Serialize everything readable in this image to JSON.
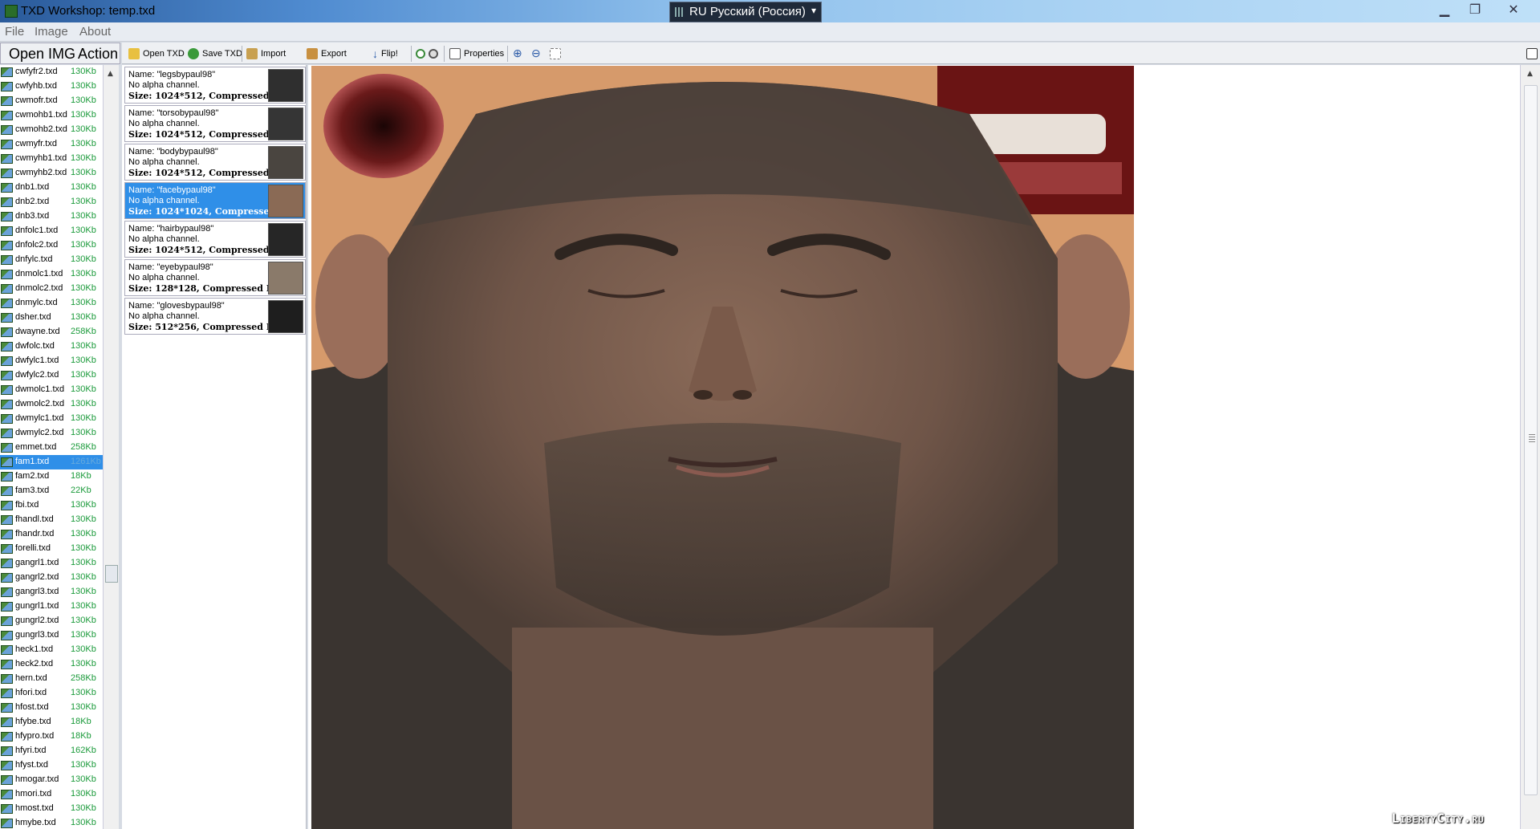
{
  "window": {
    "title": "TXD Workshop: temp.txd",
    "language_indicator": "RU Русский (Россия)",
    "controls": [
      "minimize",
      "maximize",
      "close"
    ]
  },
  "menu": [
    "File",
    "Image",
    "About"
  ],
  "left_header": {
    "tab1": "Open IMG",
    "tab2": "Action"
  },
  "toolbar": {
    "open_txd": "Open TXD",
    "save_txd": "Save TXD",
    "import": "Import",
    "export": "Export",
    "flip": "Flip!",
    "properties": "Properties"
  },
  "files": [
    {
      "name": "cwfyfr2.txd",
      "size": "130Kb"
    },
    {
      "name": "cwfyhb.txd",
      "size": "130Kb"
    },
    {
      "name": "cwmofr.txd",
      "size": "130Kb"
    },
    {
      "name": "cwmohb1.txd",
      "size": "130Kb"
    },
    {
      "name": "cwmohb2.txd",
      "size": "130Kb"
    },
    {
      "name": "cwmyfr.txd",
      "size": "130Kb"
    },
    {
      "name": "cwmyhb1.txd",
      "size": "130Kb"
    },
    {
      "name": "cwmyhb2.txd",
      "size": "130Kb"
    },
    {
      "name": "dnb1.txd",
      "size": "130Kb"
    },
    {
      "name": "dnb2.txd",
      "size": "130Kb"
    },
    {
      "name": "dnb3.txd",
      "size": "130Kb"
    },
    {
      "name": "dnfolc1.txd",
      "size": "130Kb"
    },
    {
      "name": "dnfolc2.txd",
      "size": "130Kb"
    },
    {
      "name": "dnfylc.txd",
      "size": "130Kb"
    },
    {
      "name": "dnmolc1.txd",
      "size": "130Kb"
    },
    {
      "name": "dnmolc2.txd",
      "size": "130Kb"
    },
    {
      "name": "dnmylc.txd",
      "size": "130Kb"
    },
    {
      "name": "dsher.txd",
      "size": "130Kb"
    },
    {
      "name": "dwayne.txd",
      "size": "258Kb"
    },
    {
      "name": "dwfolc.txd",
      "size": "130Kb"
    },
    {
      "name": "dwfylc1.txd",
      "size": "130Kb"
    },
    {
      "name": "dwfylc2.txd",
      "size": "130Kb"
    },
    {
      "name": "dwmolc1.txd",
      "size": "130Kb"
    },
    {
      "name": "dwmolc2.txd",
      "size": "130Kb"
    },
    {
      "name": "dwmylc1.txd",
      "size": "130Kb"
    },
    {
      "name": "dwmylc2.txd",
      "size": "130Kb"
    },
    {
      "name": "emmet.txd",
      "size": "258Kb"
    },
    {
      "name": "fam1.txd",
      "size": "1261Kb",
      "selected": true
    },
    {
      "name": "fam2.txd",
      "size": "18Kb"
    },
    {
      "name": "fam3.txd",
      "size": "22Kb"
    },
    {
      "name": "fbi.txd",
      "size": "130Kb"
    },
    {
      "name": "fhandl.txd",
      "size": "130Kb"
    },
    {
      "name": "fhandr.txd",
      "size": "130Kb"
    },
    {
      "name": "forelli.txd",
      "size": "130Kb"
    },
    {
      "name": "gangrl1.txd",
      "size": "130Kb"
    },
    {
      "name": "gangrl2.txd",
      "size": "130Kb"
    },
    {
      "name": "gangrl3.txd",
      "size": "130Kb"
    },
    {
      "name": "gungrl1.txd",
      "size": "130Kb"
    },
    {
      "name": "gungrl2.txd",
      "size": "130Kb"
    },
    {
      "name": "gungrl3.txd",
      "size": "130Kb"
    },
    {
      "name": "heck1.txd",
      "size": "130Kb"
    },
    {
      "name": "heck2.txd",
      "size": "130Kb"
    },
    {
      "name": "hern.txd",
      "size": "258Kb"
    },
    {
      "name": "hfori.txd",
      "size": "130Kb"
    },
    {
      "name": "hfost.txd",
      "size": "130Kb"
    },
    {
      "name": "hfybe.txd",
      "size": "18Kb"
    },
    {
      "name": "hfypro.txd",
      "size": "18Kb"
    },
    {
      "name": "hfyri.txd",
      "size": "162Kb"
    },
    {
      "name": "hfyst.txd",
      "size": "130Kb"
    },
    {
      "name": "hmogar.txd",
      "size": "130Kb"
    },
    {
      "name": "hmori.txd",
      "size": "130Kb"
    },
    {
      "name": "hmost.txd",
      "size": "130Kb"
    },
    {
      "name": "hmybe.txd",
      "size": "130Kb"
    }
  ],
  "textures": [
    {
      "name": "Name: \"legsbypaul98\"",
      "alpha": "No alpha channel.",
      "size": "Size: 1024*512, Compressed D",
      "thumb": "#2f2f2f"
    },
    {
      "name": "Name: \"torsobypaul98\"",
      "alpha": "No alpha channel.",
      "size": "Size: 1024*512, Compressed D",
      "thumb": "#353535"
    },
    {
      "name": "Name: \"bodybypaul98\"",
      "alpha": "No alpha channel.",
      "size": "Size: 1024*512, Compressed D",
      "thumb": "#4a4540"
    },
    {
      "name": "Name: \"facebypaul98\"",
      "alpha": "No alpha channel.",
      "size": "Size: 1024*1024, Compressed",
      "thumb": "#8a6a55",
      "selected": true
    },
    {
      "name": "Name: \"hairbypaul98\"",
      "alpha": "No alpha channel.",
      "size": "Size: 1024*512, Compressed D",
      "thumb": "#262626"
    },
    {
      "name": "Name: \"eyebypaul98\"",
      "alpha": "No alpha channel.",
      "size": "Size: 128*128, Compressed DX",
      "thumb": "#8a7a6a"
    },
    {
      "name": "Name: \"glovesbypaul98\"",
      "alpha": "No alpha channel.",
      "size": "Size: 512*256, Compressed DX",
      "thumb": "#1e1e1e"
    }
  ],
  "watermark": "LibertyCity.ru",
  "colors": {
    "selection": "#2f8fe8",
    "file_size_text": "#1a9a3a",
    "skin_background": "#d69a6b"
  }
}
